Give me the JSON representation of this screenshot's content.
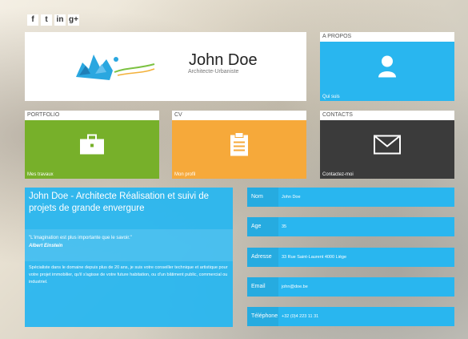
{
  "social": [
    "f",
    "t",
    "in",
    "g+"
  ],
  "hero": {
    "name": "John Doe",
    "role": "Architecte-Urbaniste"
  },
  "tiles": {
    "about": {
      "title": "A PROPOS",
      "foot": "Qui suis"
    },
    "portfolio": {
      "title": "PORTFOLIO",
      "foot": "Mes travaux"
    },
    "cv": {
      "title": "CV",
      "foot": "Mon profil"
    },
    "contacts": {
      "title": "CONTACTS",
      "foot": "Contactez-moi"
    }
  },
  "panel": {
    "title": "John Doe - Architecte Réalisation et suivi de projets de grande envergure",
    "quote": "\"L'imagination est plus importante que le savoir.\"",
    "author": "Albert Einstein",
    "desc": "Spécialiste dans le domaine depuis plus de 20 ans, je suis votre conseiller technique et artistique pour votre projet immobilier, qu'il s'agisse de votre future habitation, ou d'un bâtiment public, commercial ou industriel."
  },
  "info": [
    {
      "label": "Nom",
      "value": "John Doe"
    },
    {
      "label": "Age",
      "value": "35"
    },
    {
      "label": "Adresse",
      "value": "33 Rue Saint-Laurent 4000 Liège"
    },
    {
      "label": "Email",
      "value": "john@doe.be"
    },
    {
      "label": "Téléphone",
      "value": "+32 (0)4 223 11 31"
    }
  ]
}
